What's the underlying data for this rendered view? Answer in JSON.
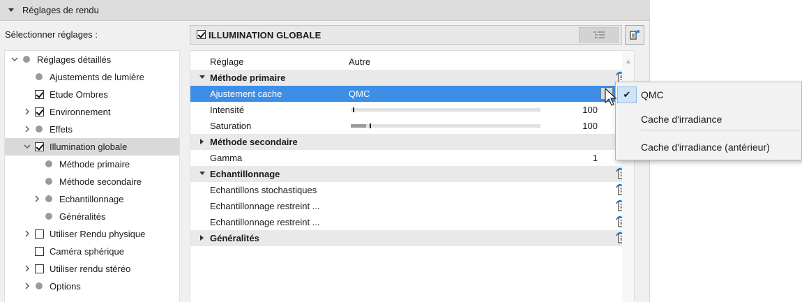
{
  "panel": {
    "title": "Réglages de rendu"
  },
  "left": {
    "select_label": "Sélectionner réglages :",
    "tree": [
      {
        "label": "Réglages détaillés",
        "kind": "dot",
        "indent": 0,
        "expander": "down",
        "selected": false
      },
      {
        "label": "Ajustements de lumière",
        "kind": "dot",
        "indent": 1,
        "expander": "",
        "selected": false
      },
      {
        "label": "Etude Ombres",
        "kind": "checked",
        "indent": 1,
        "expander": "",
        "selected": false
      },
      {
        "label": "Environnement",
        "kind": "checked",
        "indent": 1,
        "expander": "right",
        "selected": false
      },
      {
        "label": "Effets",
        "kind": "dot",
        "indent": 1,
        "expander": "right",
        "selected": false
      },
      {
        "label": "Illumination globale",
        "kind": "checked",
        "indent": 1,
        "expander": "down",
        "selected": true
      },
      {
        "label": "Méthode primaire",
        "kind": "dot",
        "indent": 2,
        "expander": "",
        "selected": false
      },
      {
        "label": "Méthode secondaire",
        "kind": "dot",
        "indent": 2,
        "expander": "",
        "selected": false
      },
      {
        "label": "Echantillonnage",
        "kind": "dot",
        "indent": 2,
        "expander": "right",
        "selected": false
      },
      {
        "label": "Généralités",
        "kind": "dot",
        "indent": 2,
        "expander": "",
        "selected": false
      },
      {
        "label": "Utiliser Rendu physique",
        "kind": "unchecked",
        "indent": 1,
        "expander": "right",
        "selected": false
      },
      {
        "label": "Caméra sphérique",
        "kind": "unchecked",
        "indent": 1,
        "expander": "",
        "selected": false
      },
      {
        "label": "Utiliser rendu stéréo",
        "kind": "unchecked",
        "indent": 1,
        "expander": "right",
        "selected": false
      },
      {
        "label": "Options",
        "kind": "dot",
        "indent": 1,
        "expander": "right",
        "selected": false
      }
    ]
  },
  "right": {
    "header_title": "ILLUMINATION GLOBALE",
    "header_checked": true,
    "rows": [
      {
        "type": "plain",
        "name": "Réglage",
        "value": "Autre",
        "num": "",
        "icon": false
      },
      {
        "type": "section",
        "name": "Méthode primaire",
        "expanded": true,
        "icon": true
      },
      {
        "type": "highlight",
        "name": "Ajustement cache",
        "value": "QMC",
        "num": "",
        "icon": false,
        "dropdown": true
      },
      {
        "type": "slider",
        "name": "Intensité",
        "fill": 0,
        "tick": 0.01,
        "num": "100",
        "icon": false
      },
      {
        "type": "slider",
        "name": "Saturation",
        "fill": 0.08,
        "tick": 0.1,
        "num": "100",
        "icon": false
      },
      {
        "type": "section",
        "name": "Méthode secondaire",
        "expanded": false,
        "icon": false
      },
      {
        "type": "plain",
        "name": "Gamma",
        "value": "",
        "num": "1",
        "icon": false
      },
      {
        "type": "section",
        "name": "Echantillonnage",
        "expanded": true,
        "icon": true
      },
      {
        "type": "plain",
        "name": "Echantillons stochastiques",
        "value": "",
        "num": "",
        "icon": true
      },
      {
        "type": "plain",
        "name": "Echantillonnage  restreint ...",
        "value": "",
        "num": "",
        "icon": true
      },
      {
        "type": "plain",
        "name": "Echantillonnage restreint  ...",
        "value": "",
        "num": "",
        "icon": true
      },
      {
        "type": "section",
        "name": "Généralités",
        "expanded": false,
        "icon": true
      }
    ]
  },
  "menu": {
    "items": [
      {
        "label": "QMC",
        "active": true
      },
      {
        "label": "Cache d'irradiance",
        "active": false
      },
      {
        "label": "Cache d'irradiance (antérieur)",
        "active": false
      }
    ]
  },
  "colors": {
    "highlight": "#3d8ee6",
    "icon_blue": "#1f7ad6"
  }
}
